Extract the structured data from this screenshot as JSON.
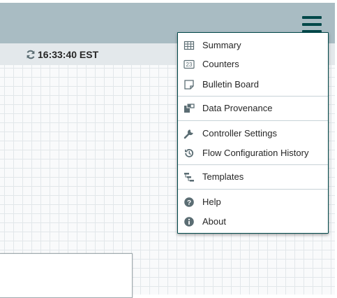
{
  "status": {
    "refresh_time": "16:33:40 EST"
  },
  "menu": {
    "items": [
      {
        "label": "Summary",
        "icon": "table-icon"
      },
      {
        "label": "Counters",
        "icon": "counter-icon"
      },
      {
        "label": "Bulletin Board",
        "icon": "sticky-note-icon"
      },
      {
        "label": "Data Provenance",
        "icon": "provenance-icon"
      },
      {
        "label": "Controller Settings",
        "icon": "wrench-icon"
      },
      {
        "label": "Flow Configuration History",
        "icon": "history-icon"
      },
      {
        "label": "Templates",
        "icon": "template-icon"
      },
      {
        "label": "Help",
        "icon": "question-circle-icon"
      },
      {
        "label": "About",
        "icon": "info-circle-icon"
      }
    ],
    "counter_glyph": "23"
  },
  "colors": {
    "header": "#a9bcc3",
    "accent": "#004849",
    "icon": "#5b6d73"
  }
}
